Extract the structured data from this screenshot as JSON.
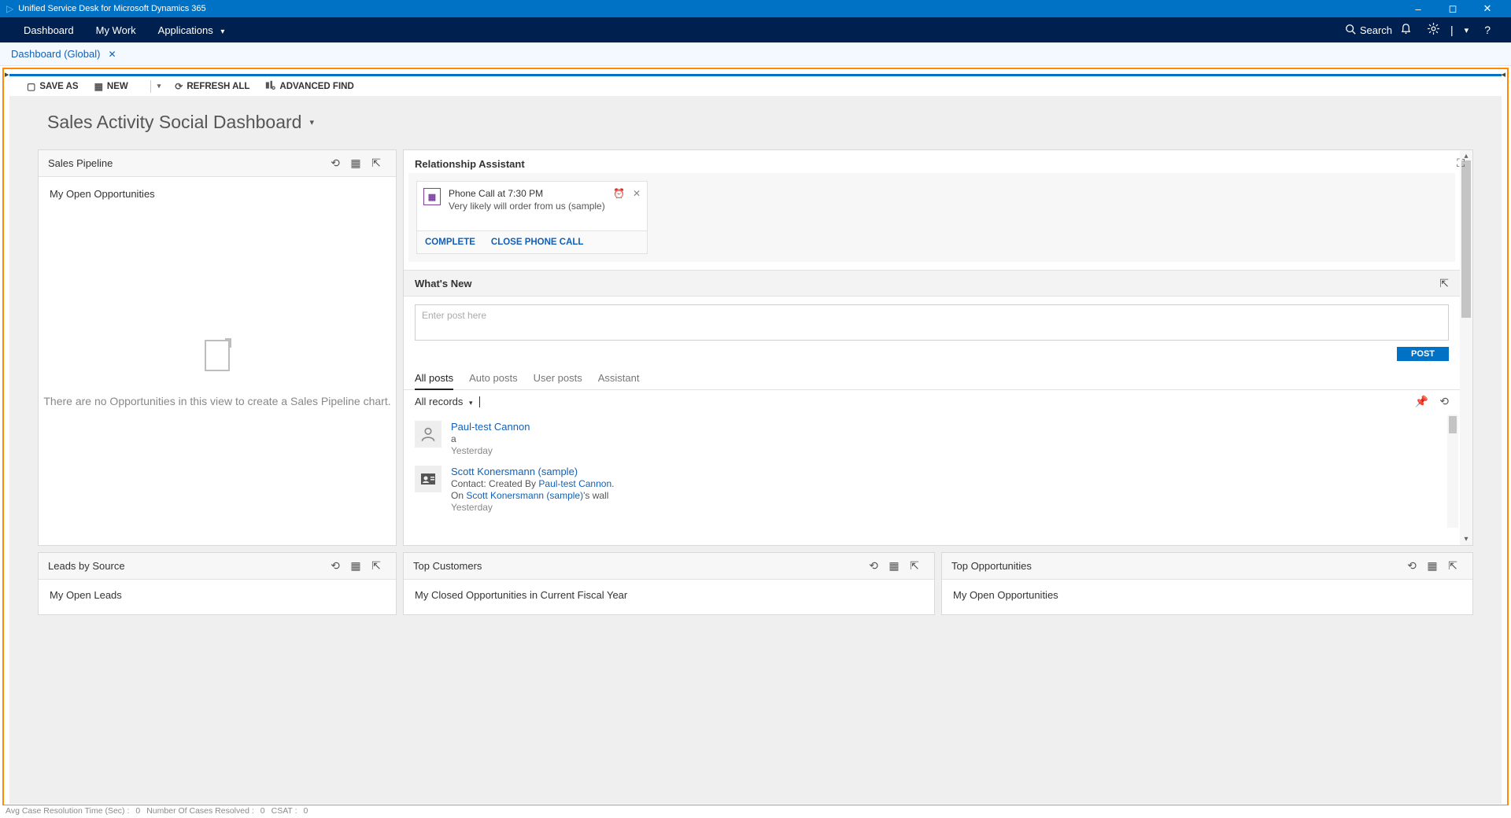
{
  "window": {
    "title": "Unified Service Desk for Microsoft Dynamics 365"
  },
  "nav": {
    "dashboard": "Dashboard",
    "mywork": "My Work",
    "applications": "Applications",
    "search": "Search"
  },
  "tabs": {
    "global": "Dashboard (Global)"
  },
  "commands": {
    "save_as": "SAVE AS",
    "new": "NEW",
    "refresh_all": "REFRESH ALL",
    "advanced_find": "ADVANCED FIND"
  },
  "dashboard": {
    "title": "Sales Activity Social Dashboard"
  },
  "pipeline": {
    "title": "Sales Pipeline",
    "subtitle": "My Open Opportunities",
    "empty": "There are no Opportunities in this view to create a Sales Pipeline chart."
  },
  "relationship": {
    "title": "Relationship Assistant",
    "card": {
      "line1": "Phone Call at 7:30 PM",
      "line2": "Very likely will order from us (sample)",
      "complete": "COMPLETE",
      "close_call": "CLOSE PHONE CALL"
    }
  },
  "whatsnew": {
    "title": "What's New",
    "placeholder": "Enter post here",
    "post_btn": "POST",
    "tabs": {
      "all": "All posts",
      "auto": "Auto posts",
      "user": "User posts",
      "assistant": "Assistant"
    },
    "filter": "All records",
    "posts": [
      {
        "name": "Paul-test Cannon",
        "body": "a",
        "time": "Yesterday"
      },
      {
        "name": "Scott Konersmann (sample)",
        "body_prefix": "Contact: Created By ",
        "body_link": "Paul-test Cannon",
        "body_suffix": ".",
        "body2_prefix": "On ",
        "body2_link": "Scott Konersmann (sample)",
        "body2_suffix": "'s wall",
        "time": "Yesterday"
      }
    ]
  },
  "bottom_panels": {
    "leads": {
      "title": "Leads by Source",
      "sub": "My Open Leads"
    },
    "customers": {
      "title": "Top Customers",
      "sub": "My Closed Opportunities in Current Fiscal Year"
    },
    "opps": {
      "title": "Top Opportunities",
      "sub": "My Open Opportunities"
    }
  },
  "status": {
    "a": "Avg Case Resolution Time (Sec) :",
    "a_v": "0",
    "b": "Number Of Cases Resolved :",
    "b_v": "0",
    "c": "CSAT :",
    "c_v": "0"
  }
}
